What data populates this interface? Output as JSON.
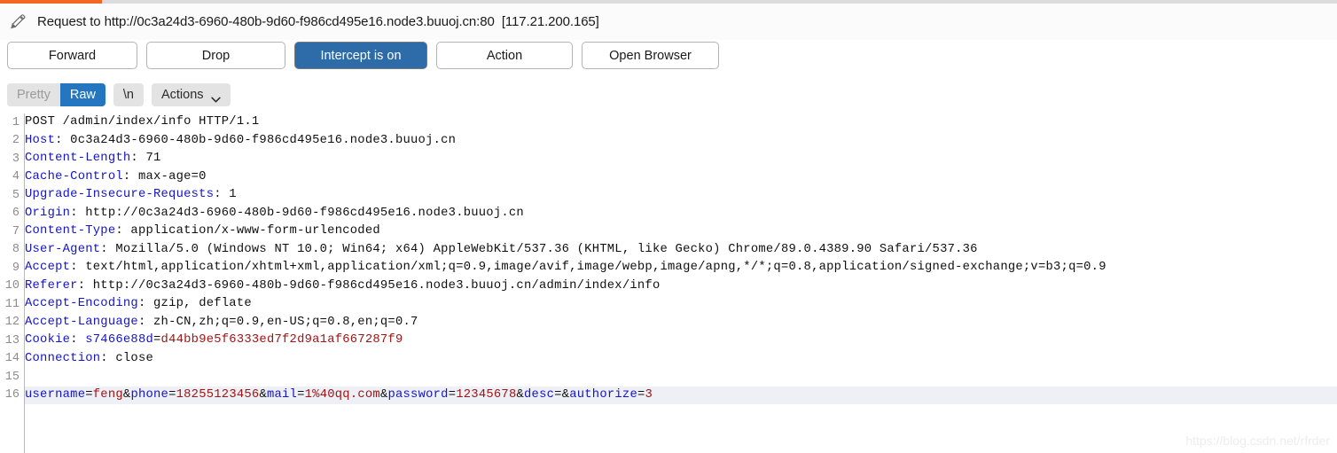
{
  "window": {
    "accent_color": "#f26522",
    "title": "Request to http://0c3a24d3-6960-480b-9d60-f986cd495e16.node3.buuoj.cn:80  [117.21.200.165]",
    "pencil_icon": "pencil-icon"
  },
  "toolbar": {
    "forward_label": "Forward",
    "drop_label": "Drop",
    "intercept_label": "Intercept is on",
    "action_label": "Action",
    "open_browser_label": "Open Browser",
    "intercept_active_color": "#2d6ca8"
  },
  "viewbar": {
    "pretty_label": "Pretty",
    "raw_label": "Raw",
    "newline_label": "\\n",
    "actions_label": "Actions",
    "chevron_icon": "chevron-down-icon",
    "active_tab": "Raw",
    "active_color": "#2576c0"
  },
  "editor": {
    "highlight_line": 16,
    "header_color": "#1414c8",
    "value_color": "#a01414",
    "lines": [
      {
        "num": "1",
        "parts": [
          {
            "text": "POST /admin/index/info HTTP/1.1",
            "cls": "k-plain"
          }
        ]
      },
      {
        "num": "2",
        "parts": [
          {
            "text": "Host",
            "cls": "k-header"
          },
          {
            "text": ": 0c3a24d3-6960-480b-9d60-f986cd495e16.node3.buuoj.cn",
            "cls": "k-val"
          }
        ]
      },
      {
        "num": "3",
        "parts": [
          {
            "text": "Content-Length",
            "cls": "k-header"
          },
          {
            "text": ": 71",
            "cls": "k-val"
          }
        ]
      },
      {
        "num": "4",
        "parts": [
          {
            "text": "Cache-Control",
            "cls": "k-header"
          },
          {
            "text": ": max-age=0",
            "cls": "k-val"
          }
        ]
      },
      {
        "num": "5",
        "parts": [
          {
            "text": "Upgrade-Insecure-Requests",
            "cls": "k-header"
          },
          {
            "text": ": 1",
            "cls": "k-val"
          }
        ]
      },
      {
        "num": "6",
        "parts": [
          {
            "text": "Origin",
            "cls": "k-header"
          },
          {
            "text": ": http://0c3a24d3-6960-480b-9d60-f986cd495e16.node3.buuoj.cn",
            "cls": "k-val"
          }
        ]
      },
      {
        "num": "7",
        "parts": [
          {
            "text": "Content-Type",
            "cls": "k-header"
          },
          {
            "text": ": application/x-www-form-urlencoded",
            "cls": "k-val"
          }
        ]
      },
      {
        "num": "8",
        "parts": [
          {
            "text": "User-Agent",
            "cls": "k-header"
          },
          {
            "text": ": Mozilla/5.0 (Windows NT 10.0; Win64; x64) AppleWebKit/537.36 (KHTML, like Gecko) Chrome/89.0.4389.90 Safari/537.36",
            "cls": "k-val"
          }
        ]
      },
      {
        "num": "9",
        "parts": [
          {
            "text": "Accept",
            "cls": "k-header"
          },
          {
            "text": ": text/html,application/xhtml+xml,application/xml;q=0.9,image/avif,image/webp,image/apng,*/*;q=0.8,application/signed-exchange;v=b3;q=0.9",
            "cls": "k-val"
          }
        ]
      },
      {
        "num": "10",
        "parts": [
          {
            "text": "Referer",
            "cls": "k-header"
          },
          {
            "text": ": http://0c3a24d3-6960-480b-9d60-f986cd495e16.node3.buuoj.cn/admin/index/info",
            "cls": "k-val"
          }
        ]
      },
      {
        "num": "11",
        "parts": [
          {
            "text": "Accept-Encoding",
            "cls": "k-header"
          },
          {
            "text": ": gzip, deflate",
            "cls": "k-val"
          }
        ]
      },
      {
        "num": "12",
        "parts": [
          {
            "text": "Accept-Language",
            "cls": "k-header"
          },
          {
            "text": ": zh-CN,zh;q=0.9,en-US;q=0.8,en;q=0.7",
            "cls": "k-val"
          }
        ]
      },
      {
        "num": "13",
        "parts": [
          {
            "text": "Cookie",
            "cls": "k-header"
          },
          {
            "text": ": ",
            "cls": "k-val"
          },
          {
            "text": "s7466e88d",
            "cls": "k-param"
          },
          {
            "text": "=",
            "cls": "k-plain"
          },
          {
            "text": "d44bb9e5f6333ed7f2d9a1af667287f9",
            "cls": "k-pval"
          }
        ]
      },
      {
        "num": "14",
        "parts": [
          {
            "text": "Connection",
            "cls": "k-header"
          },
          {
            "text": ": close",
            "cls": "k-val"
          }
        ]
      },
      {
        "num": "15",
        "parts": []
      },
      {
        "num": "16",
        "highlight": true,
        "parts": [
          {
            "text": "username",
            "cls": "k-param"
          },
          {
            "text": "=",
            "cls": "k-plain"
          },
          {
            "text": "feng",
            "cls": "k-pval"
          },
          {
            "text": "&",
            "cls": "k-plain"
          },
          {
            "text": "phone",
            "cls": "k-param"
          },
          {
            "text": "=",
            "cls": "k-plain"
          },
          {
            "text": "18255123456",
            "cls": "k-pval"
          },
          {
            "text": "&",
            "cls": "k-plain"
          },
          {
            "text": "mail",
            "cls": "k-param"
          },
          {
            "text": "=",
            "cls": "k-plain"
          },
          {
            "text": "1%40qq.com",
            "cls": "k-pval"
          },
          {
            "text": "&",
            "cls": "k-plain"
          },
          {
            "text": "password",
            "cls": "k-param"
          },
          {
            "text": "=",
            "cls": "k-plain"
          },
          {
            "text": "12345678",
            "cls": "k-pval"
          },
          {
            "text": "&",
            "cls": "k-plain"
          },
          {
            "text": "desc",
            "cls": "k-param"
          },
          {
            "text": "=",
            "cls": "k-plain"
          },
          {
            "text": "&",
            "cls": "k-plain"
          },
          {
            "text": "authorize",
            "cls": "k-param"
          },
          {
            "text": "=",
            "cls": "k-plain"
          },
          {
            "text": "3",
            "cls": "k-pval"
          }
        ]
      }
    ]
  },
  "watermark": {
    "text": "https://blog.csdn.net/rfrder"
  }
}
